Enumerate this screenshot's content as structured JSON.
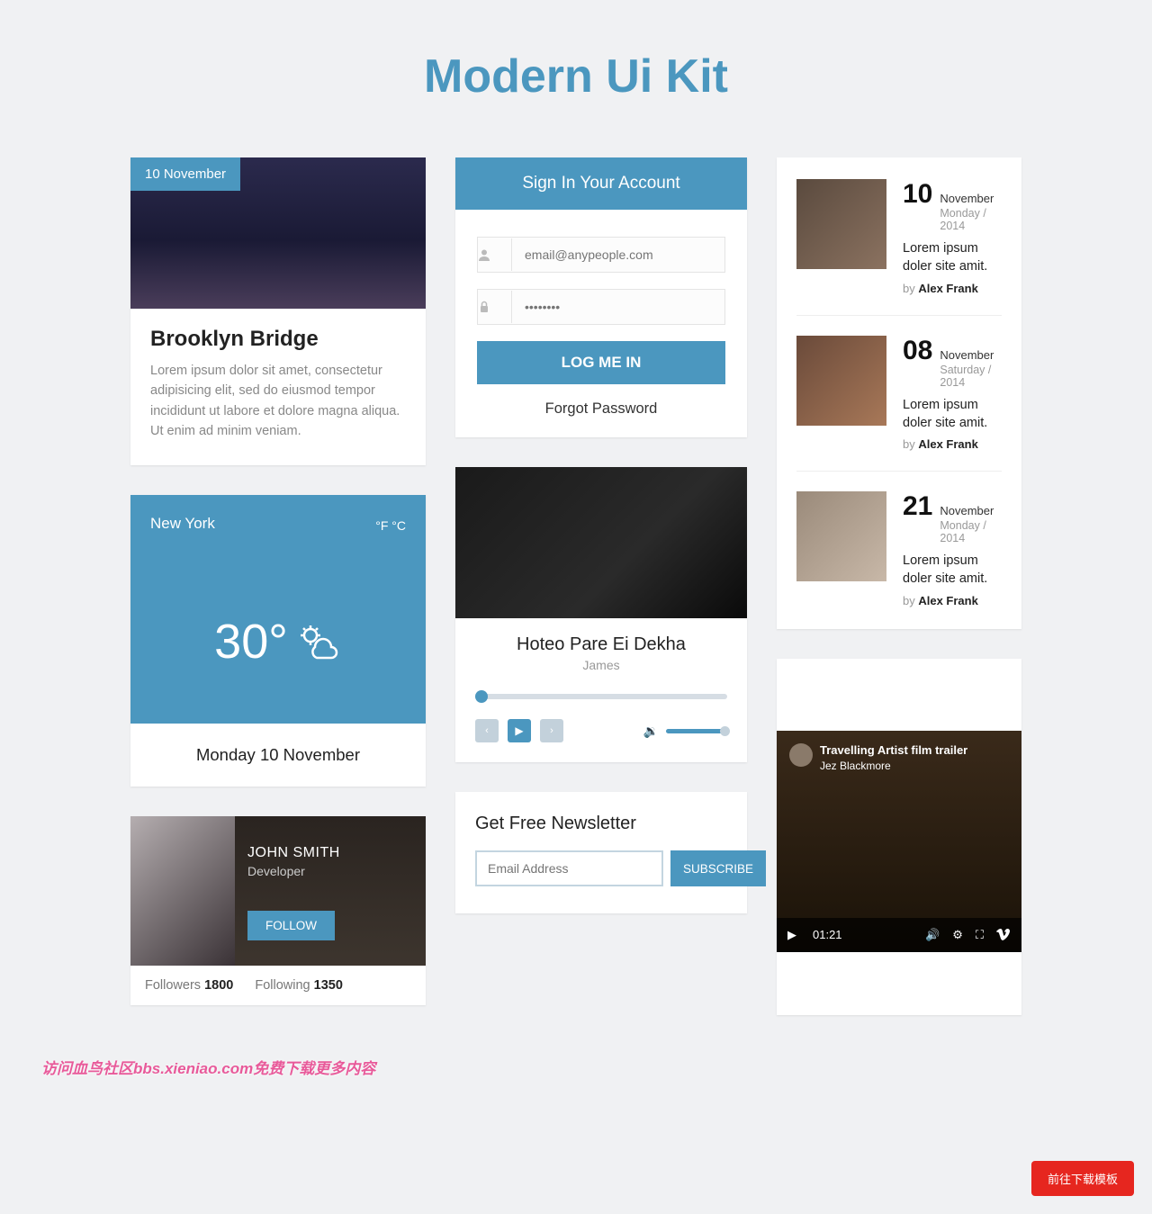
{
  "title": "Modern Ui Kit",
  "article": {
    "date": "10 November",
    "heading": "Brooklyn Bridge",
    "text": "Lorem ipsum dolor sit amet, consectetur adipisicing elit, sed do eiusmod tempor incididunt ut labore et dolore magna aliqua. Ut enim ad minim veniam."
  },
  "weather": {
    "city": "New York",
    "units": "°F °C",
    "temp": "30°",
    "date": "Monday 10 November"
  },
  "profile": {
    "name": "JOHN SMITH",
    "role": "Developer",
    "follow": "FOLLOW",
    "followers_label": "Followers",
    "followers": "1800",
    "following_label": "Following",
    "following": "1350"
  },
  "signin": {
    "title": "Sign In Your Account",
    "email_placeholder": "email@anypeople.com",
    "password_placeholder": "••••••••",
    "login": "LOG ME IN",
    "forgot": "Forgot Password"
  },
  "player": {
    "track": "Hoteo Pare Ei Dekha",
    "artist": "James"
  },
  "newsletter": {
    "title": "Get Free Newsletter",
    "placeholder": "Email Address",
    "button": "SUBSCRIBE"
  },
  "posts": [
    {
      "day": "10",
      "month": "November",
      "sub": "Monday / 2014",
      "text": "Lorem ipsum doler site amit.",
      "by": "by ",
      "author": "Alex Frank"
    },
    {
      "day": "08",
      "month": "November",
      "sub": "Saturday / 2014",
      "text": "Lorem ipsum doler site amit.",
      "by": "by ",
      "author": "Alex Frank"
    },
    {
      "day": "21",
      "month": "November",
      "sub": "Monday / 2014",
      "text": "Lorem ipsum doler site amit.",
      "by": "by ",
      "author": "Alex Frank"
    }
  ],
  "video": {
    "title": "Travelling Artist film trailer",
    "author": "Jez Blackmore",
    "time": "01:21"
  },
  "download": "前往下载模板",
  "watermark": "访问血鸟社区bbs.xieniao.com免费下载更多内容"
}
